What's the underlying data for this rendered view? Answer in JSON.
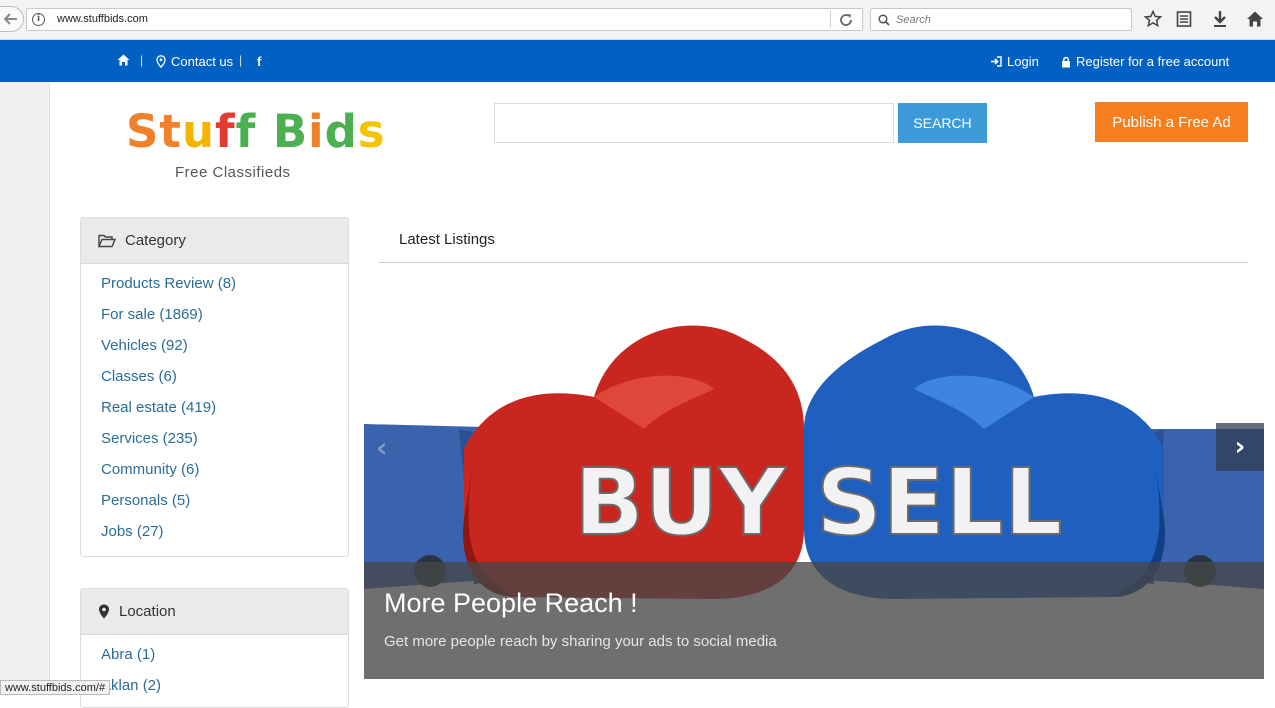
{
  "browser": {
    "url": "www.stuffbids.com",
    "search_placeholder": "Search",
    "status_url": "www.stuffbids.com/#"
  },
  "topnav": {
    "contact_label": "Contact us",
    "facebook_label": "f",
    "login_label": "Login",
    "register_label": "Register for a free account"
  },
  "header": {
    "logo_letters": [
      {
        "char": "S",
        "color": "#f0812a"
      },
      {
        "char": "t",
        "color": "#f0812a"
      },
      {
        "char": "u",
        "color": "#f5b400"
      },
      {
        "char": "f",
        "color": "#e33b2f"
      },
      {
        "char": "f",
        "color": "#4caf50"
      },
      {
        "char": " ",
        "color": "#ffffff"
      },
      {
        "char": "B",
        "color": "#4caf50"
      },
      {
        "char": "i",
        "color": "#f0812a"
      },
      {
        "char": "d",
        "color": "#4caf50"
      },
      {
        "char": "s",
        "color": "#f5c400"
      }
    ],
    "tagline": "Free Classifieds",
    "search_button": "SEARCH",
    "publish_button": "Publish a Free Ad"
  },
  "category": {
    "title": "Category",
    "items": [
      {
        "label": "Products Review (8)"
      },
      {
        "label": "For sale (1869)"
      },
      {
        "label": "Vehicles (92)"
      },
      {
        "label": "Classes (6)"
      },
      {
        "label": "Real estate (419)"
      },
      {
        "label": "Services (235)"
      },
      {
        "label": "Community (6)"
      },
      {
        "label": "Personals (5)"
      },
      {
        "label": "Jobs (27)"
      }
    ]
  },
  "location": {
    "title": "Location",
    "items": [
      {
        "label": "Abra (1)"
      },
      {
        "label": "Aklan (2)"
      }
    ]
  },
  "listings": {
    "title": "Latest Listings",
    "slide": {
      "left_word": "BUY",
      "right_word": "SELL",
      "caption_title": "More People Reach !",
      "caption_text": "Get more people reach by sharing your ads to social media"
    }
  },
  "colors": {
    "nav_blue": "#0061c2",
    "search_blue": "#3d9ad8",
    "publish_orange": "#f67e1e",
    "link_blue": "#2a6c9a"
  }
}
